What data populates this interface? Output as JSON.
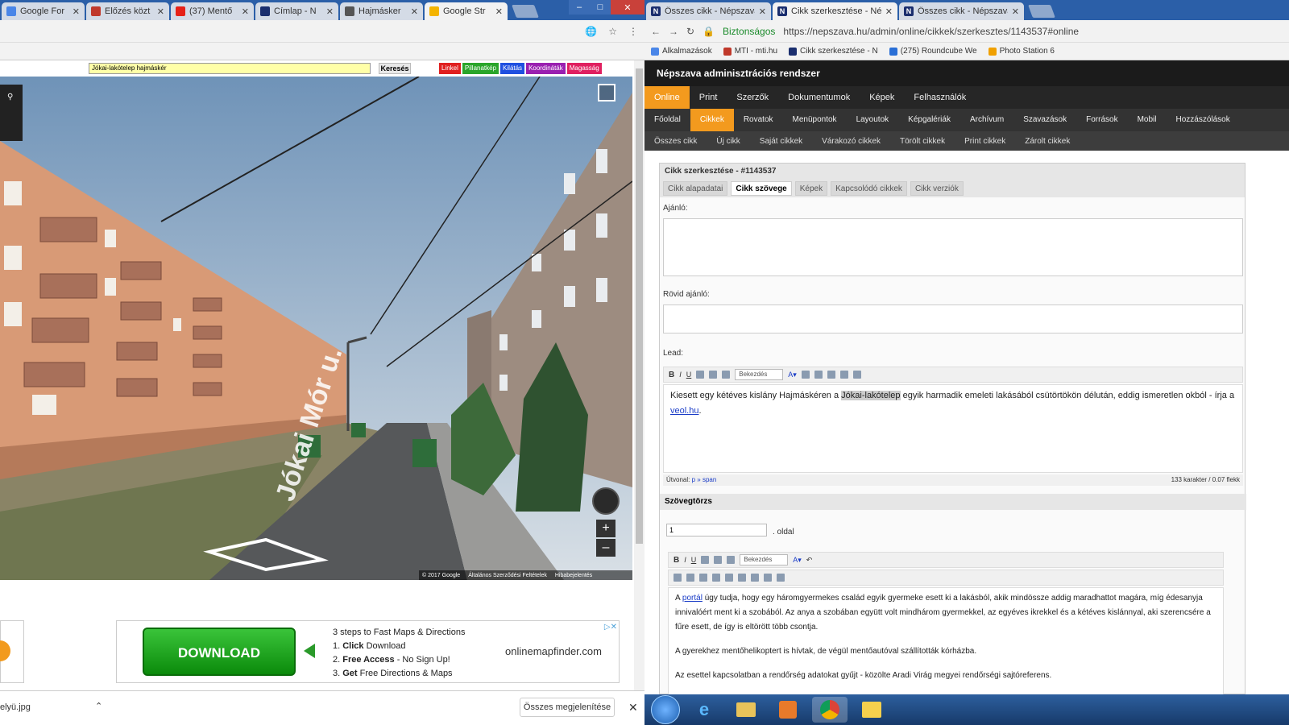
{
  "left_browser": {
    "tabs": [
      {
        "label": "Google For",
        "fav_color": "#4a86e8"
      },
      {
        "label": "Előzés közt",
        "fav_color": "#c0392b"
      },
      {
        "label": "(37) Mentő",
        "fav_color": "#e62117"
      },
      {
        "label": "Címlap - N",
        "fav_color": "#1a2e6e"
      },
      {
        "label": "Hajmásker",
        "fav_color": "#555555"
      },
      {
        "label": "Google Str",
        "fav_color": "#f4b400"
      }
    ],
    "map_search_value": "Jókai-lakótelep hajmáskér",
    "search_button": "Keresés",
    "chips": [
      {
        "label": "Linkel",
        "color": "#e02020"
      },
      {
        "label": "Pillanatkép",
        "color": "#2aa52a"
      },
      {
        "label": "Kilátás",
        "color": "#2050e0"
      },
      {
        "label": "Koordináták",
        "color": "#9a20b0"
      },
      {
        "label": "Magasság",
        "color": "#e02060"
      }
    ],
    "street_label": "Jókai Mór u.",
    "sv_footer": [
      "© 2017 Google",
      "Általános Szerződési Feltételek",
      "Hibabejelentés"
    ],
    "ad": {
      "download": "DOWNLOAD",
      "steps_title": "3 steps to Fast Maps & Directions",
      "steps": [
        {
          "n": "1.",
          "bold": "Click",
          "rest": "Download"
        },
        {
          "n": "2.",
          "bold": "Free Access",
          "rest": "- No Sign Up!"
        },
        {
          "n": "3.",
          "bold": "Get",
          "rest": "Free Directions & Maps"
        }
      ],
      "url": "onlinemapfinder.com"
    },
    "download_file": "elyü.jpg",
    "show_all": "Összes megjelenítése"
  },
  "right_browser": {
    "tabs": [
      {
        "label": "Összes cikk - Népszava"
      },
      {
        "label": "Cikk szerkesztése - Népsz"
      },
      {
        "label": "Összes cikk - Népszava"
      }
    ],
    "secure_label": "Biztonságos",
    "url": "https://nepszava.hu/admin/online/cikkek/szerkesztes/1143537#online",
    "bookmarks": [
      "Alkalmazások",
      "MTI - mti.hu",
      "Cikk szerkesztése - N",
      "(275) Roundcube We",
      "Photo Station 6"
    ],
    "admin_title": "Népszava adminisztrációs rendszer",
    "nav1": [
      "Online",
      "Print",
      "Szerzők",
      "Dokumentumok",
      "Képek",
      "Felhasználók"
    ],
    "nav2": [
      "Főoldal",
      "Cikkek",
      "Rovatok",
      "Menüpontok",
      "Layoutok",
      "Képgalériák",
      "Archívum",
      "Szavazások",
      "Források",
      "Mobil",
      "Hozzászólások"
    ],
    "nav3": [
      "Összes cikk",
      "Új cikk",
      "Saját cikkek",
      "Várakozó cikkek",
      "Törölt cikkek",
      "Print cikkek",
      "Zárolt cikkek"
    ],
    "panel_title": "Cikk szerkesztése - #1143537",
    "subtabs": [
      "Cikk alapadatai",
      "Cikk szövege",
      "Képek",
      "Kapcsolódó cikkek",
      "Cikk verziók"
    ],
    "labels": {
      "ajanlo": "Ajánló:",
      "rovid": "Rövid ajánló:",
      "lead": "Lead:",
      "szoveg": "Szövegtörzs",
      "oldal": ". oldal"
    },
    "format_select": "Bekezdés",
    "lead_pre": "Kiesett egy kétéves kislány Hajmáskéren a ",
    "lead_hl": "Jókai-lakótelep",
    "lead_mid": " egyik harmadik emeleti lakásából csütörtökön délután, eddig ismeretlen okból - írja a ",
    "lead_link": "veol.hu",
    "lead_end": ".",
    "path_label": "Útvonal:",
    "path_value": "p » span",
    "char_count": "133 karakter / 0.07 flekk",
    "page_number": "1",
    "body_p1_link": "portál",
    "body_p1": " úgy tudja, hogy egy háromgyermekes család egyik gyermeke esett ki a lakásból, akik mindössze addig maradhattot magára, míg édesanyja innivalóért ment ki a szobából. Az anya a szobában együtt volt mindhárom gyermekkel, az egyéves ikrekkel és a kétéves kislánnyal, aki szerencsére a fűre esett, de így is eltörött több csontja.",
    "body_p1_pre": "A ",
    "body_p2": "A gyerekhez mentőhelikoptert is hívtak, de végül mentőautóval szállították kórházba.",
    "body_p3": "Az esettel kapcsolatban a rendőrség adatokat gyűjt - közölte Aradi Virág megyei rendőrségi sajtóreferens."
  },
  "taskbar": {
    "items": [
      "start",
      "ie",
      "explorer",
      "media",
      "chrome",
      "folder"
    ]
  }
}
